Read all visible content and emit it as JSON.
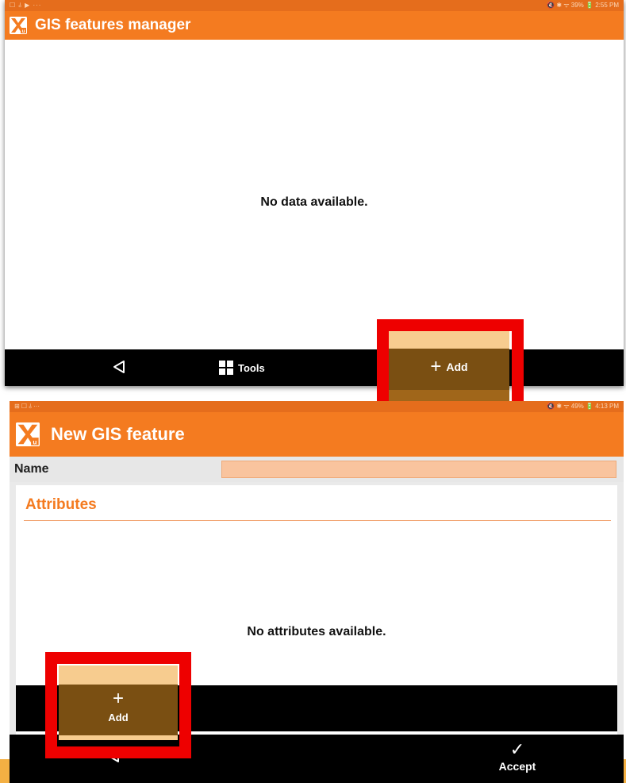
{
  "screen1": {
    "status_left": "☐ ⫰ ▶ ···",
    "status_right": "🔇 ✱ ᯤ 39% 🔋 2:55 PM",
    "title": "GIS features manager",
    "empty_message": "No data available.",
    "tools_label": "Tools",
    "add_label": "Add"
  },
  "screen2": {
    "status_left": "⊞ ☐ ⫰ ···",
    "status_right": "🔇 ✱ ᯤ 49% 🔋 4:13 PM",
    "title": "New GIS feature",
    "name_label": "Name",
    "name_value": "",
    "attributes_title": "Attributes",
    "empty_message": "No attributes available.",
    "add_label": "Add",
    "accept_label": "Accept"
  },
  "colors": {
    "app_orange": "#f47b20",
    "highlight_red": "#ee0000",
    "add_button_brown": "#7a4f12"
  },
  "icons": {
    "back": "triangle-back-icon",
    "tools": "grid-icon",
    "add": "plus-icon",
    "accept": "check-icon",
    "logo": "xpad-logo-icon"
  }
}
